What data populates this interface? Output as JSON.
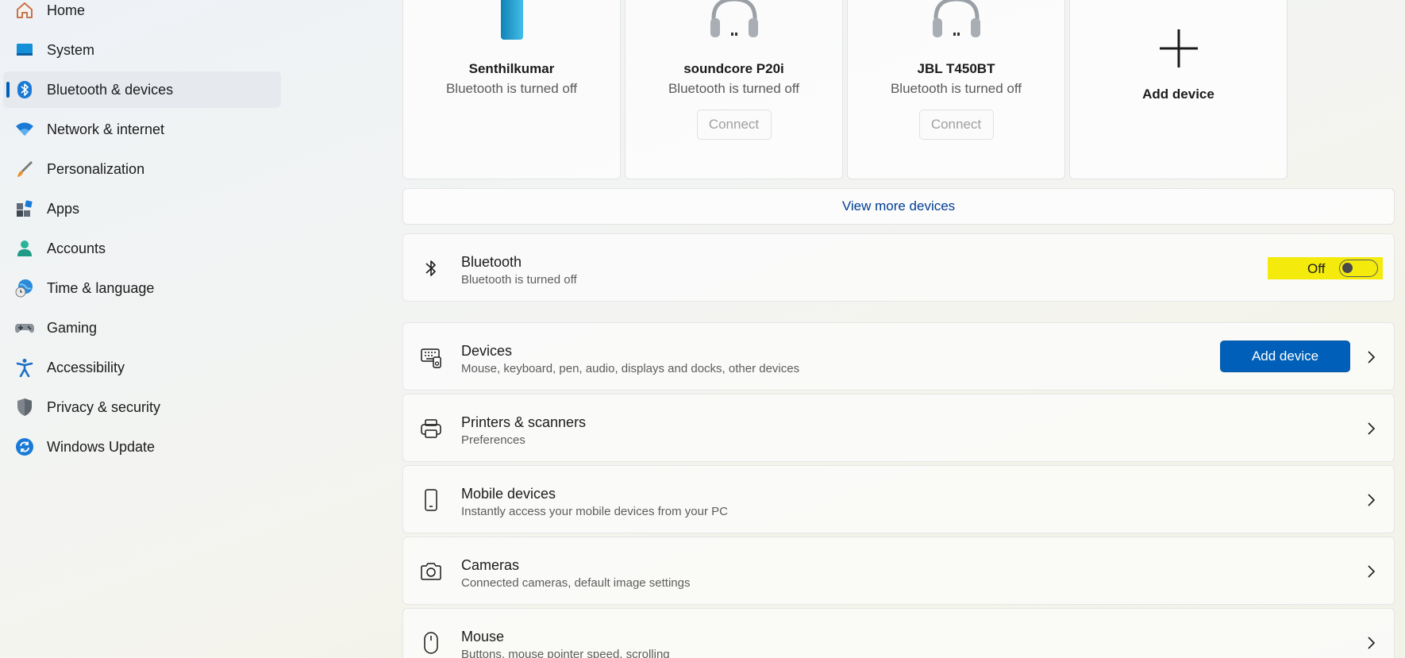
{
  "sidebar": {
    "items": [
      {
        "label": "Home",
        "icon": "home-icon"
      },
      {
        "label": "System",
        "icon": "system-icon"
      },
      {
        "label": "Bluetooth & devices",
        "icon": "bluetooth-icon",
        "selected": true
      },
      {
        "label": "Network & internet",
        "icon": "wifi-icon"
      },
      {
        "label": "Personalization",
        "icon": "brush-icon"
      },
      {
        "label": "Apps",
        "icon": "apps-icon"
      },
      {
        "label": "Accounts",
        "icon": "person-icon"
      },
      {
        "label": "Time & language",
        "icon": "globe-clock-icon"
      },
      {
        "label": "Gaming",
        "icon": "gamepad-icon"
      },
      {
        "label": "Accessibility",
        "icon": "accessibility-icon"
      },
      {
        "label": "Privacy & security",
        "icon": "shield-icon"
      },
      {
        "label": "Windows Update",
        "icon": "update-icon"
      }
    ]
  },
  "devices": {
    "cards": [
      {
        "name": "Senthilkumar",
        "status": "Bluetooth is turned off",
        "icon": "phone-icon"
      },
      {
        "name": "soundcore P20i",
        "status": "Bluetooth is turned off",
        "icon": "headphones-icon",
        "button": "Connect"
      },
      {
        "name": "JBL T450BT",
        "status": "Bluetooth is turned off",
        "icon": "headphones-icon",
        "button": "Connect"
      }
    ],
    "add_card_label": "Add device",
    "view_more": "View more devices"
  },
  "bluetooth": {
    "title": "Bluetooth",
    "subtitle": "Bluetooth is turned off",
    "toggle_label": "Off",
    "toggle_on": false,
    "highlight_color": "#f4ea0c"
  },
  "rows": [
    {
      "title": "Devices",
      "subtitle": "Mouse, keyboard, pen, audio, displays and docks, other devices",
      "button": "Add device",
      "icon": "keyboard-devices-icon"
    },
    {
      "title": "Printers & scanners",
      "subtitle": "Preferences",
      "icon": "printer-icon"
    },
    {
      "title": "Mobile devices",
      "subtitle": "Instantly access your mobile devices from your PC",
      "icon": "mobile-icon"
    },
    {
      "title": "Cameras",
      "subtitle": "Connected cameras, default image settings",
      "icon": "camera-icon"
    },
    {
      "title": "Mouse",
      "subtitle": "Buttons, mouse pointer speed, scrolling",
      "icon": "mouse-icon"
    }
  ],
  "colors": {
    "accent": "#005fb8",
    "link": "#003e92"
  }
}
